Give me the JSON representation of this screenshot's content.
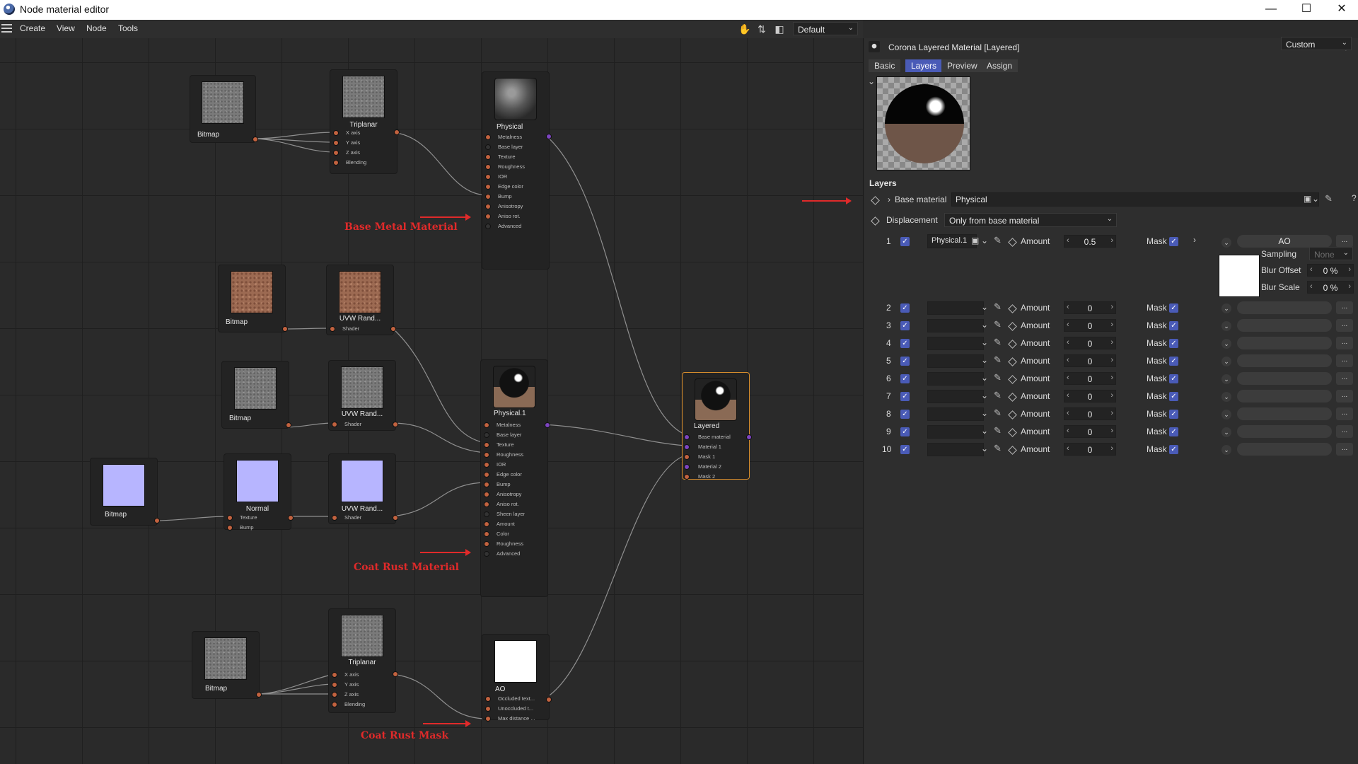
{
  "window": {
    "title": "Node material editor",
    "controls": [
      "—",
      "☐",
      "✕"
    ]
  },
  "menu": {
    "items": [
      "Create",
      "View",
      "Node",
      "Tools"
    ],
    "layout_select": "Default"
  },
  "nodes": {
    "bitmap": "Bitmap",
    "triplanar": "Triplanar",
    "uvw": "UVW Rand...",
    "normal": "Normal",
    "physical": "Physical",
    "physical1": "Physical.1",
    "layered": "Layered",
    "ao": "AO",
    "triplanar_ports": [
      "X axis",
      "Y axis",
      "Z axis",
      "Blending"
    ],
    "uvw_ports": [
      "Shader"
    ],
    "normal_ports": [
      "Texture",
      "Bump"
    ],
    "physical_ports": [
      "Metalness",
      "Base layer",
      "Texture",
      "Roughness",
      "IOR",
      "Edge color",
      "Bump",
      "Anisotropy",
      "Aniso rot.",
      "Advanced"
    ],
    "physical1_ports": [
      "Metalness",
      "Base layer",
      "Texture",
      "Roughness",
      "IOR",
      "Edge color",
      "Bump",
      "Anisotropy",
      "Aniso rot.",
      "Sheen layer",
      "Amount",
      "Color",
      "Roughness",
      "Advanced"
    ],
    "layered_ports": [
      "Base material",
      "Material 1",
      "Mask 1",
      "Material 2",
      "Mask 2"
    ],
    "ao_ports": [
      "Occluded text...",
      "Unoccluded t...",
      "Max distance ..."
    ]
  },
  "annotations": {
    "base_metal": "Base Metal Material",
    "coat_rust": "Coat Rust Material",
    "coat_rust_mask": "Coat Rust Mask"
  },
  "panel": {
    "title": "Corona Layered Material [Layered]",
    "preset": "Custom",
    "tabs": [
      "Basic",
      "Layers",
      "Preview",
      "Assign"
    ],
    "active_tab": "Layers",
    "section": "Layers",
    "base_label": "Base material",
    "base_value": "Physical",
    "displacement_label": "Displacement",
    "displacement_value": "Only from base material",
    "amount_label": "Amount",
    "mask_label": "Mask",
    "layer1": {
      "index": "1",
      "material": "Physical.1",
      "amount": "0.5",
      "mask_name": "AO",
      "sampling_label": "Sampling",
      "sampling_value": "None",
      "blur_offset_label": "Blur Offset",
      "blur_offset_value": "0 %",
      "blur_scale_label": "Blur Scale",
      "blur_scale_value": "0 %"
    },
    "layers": [
      {
        "index": "2",
        "amount": "0"
      },
      {
        "index": "3",
        "amount": "0"
      },
      {
        "index": "4",
        "amount": "0"
      },
      {
        "index": "5",
        "amount": "0"
      },
      {
        "index": "6",
        "amount": "0"
      },
      {
        "index": "7",
        "amount": "0"
      },
      {
        "index": "8",
        "amount": "0"
      },
      {
        "index": "9",
        "amount": "0"
      },
      {
        "index": "10",
        "amount": "0"
      }
    ],
    "more": "...",
    "question": "?"
  },
  "colors": {
    "accent": "#4a5bb7",
    "selected_node": "#d58c2c",
    "annotation": "#e02a2a",
    "port": "#c2623f",
    "port_material": "#7d45c0"
  }
}
